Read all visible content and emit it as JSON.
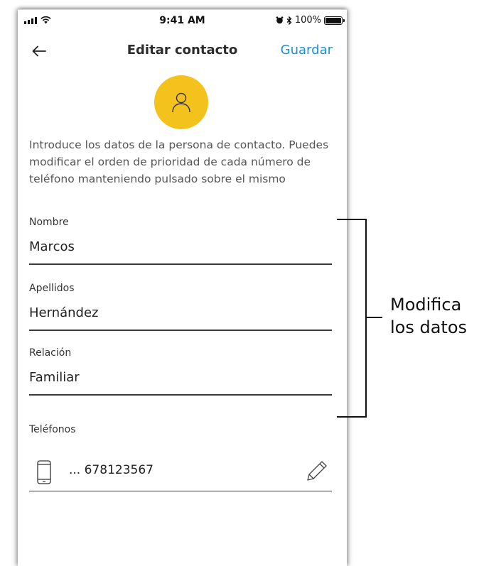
{
  "status_bar": {
    "time": "9:41 AM",
    "battery": "100%",
    "icons": [
      "signal-icon",
      "wifi-icon",
      "alarm-icon",
      "bluetooth-icon",
      "battery-icon"
    ]
  },
  "nav": {
    "back_icon": "arrow-left-icon",
    "title": "Editar contacto",
    "save_label": "Guardar"
  },
  "avatar": {
    "icon": "person-icon",
    "color": "#F4C21C"
  },
  "intro": "Introduce los datos de la persona de contacto. Puedes modificar el orden de prioridad de cada número de teléfono manteniendo pulsado sobre el mismo",
  "fields": [
    {
      "label": "Nombre",
      "value": "Marcos"
    },
    {
      "label": "Apellidos",
      "value": "Hernández"
    },
    {
      "label": "Relación",
      "value": "Familiar"
    }
  ],
  "phones": {
    "label": "Teléfonos",
    "items": [
      {
        "icon": "mobile-phone-icon",
        "number": "... 678123567",
        "edit_icon": "pencil-icon"
      }
    ]
  },
  "annotation": {
    "line1": "Modifica",
    "line2": "los datos"
  },
  "colors": {
    "accent": "#1A90D9",
    "avatar": "#F4C21C",
    "text": "#222222"
  }
}
